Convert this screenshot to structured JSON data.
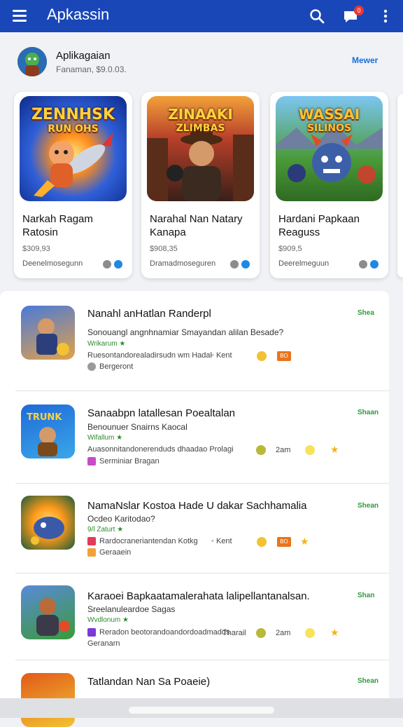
{
  "app": {
    "title": "Apkassin",
    "notification_count": "0"
  },
  "colors": {
    "primary": "#1a47b8",
    "accent_green": "#2e9b3a",
    "link_blue": "#1a6fd6"
  },
  "profile": {
    "name": "Aplikagaian",
    "subtitle": "Fanaman, $9.0.03.",
    "link": "Mewer"
  },
  "featured": [
    {
      "art_title": "ZENNHSK",
      "art_sub": "RUN OHS",
      "title": "Narkah Ragam Ratosin",
      "price": "$309,93",
      "developer": "Deenelmosegunn"
    },
    {
      "art_title": "ZINAAKI",
      "art_sub": "ZLIMBAS",
      "title": "Narahal Nan Natary Kanapa",
      "price": "$908,35",
      "developer": "Dramadmoseguren"
    },
    {
      "art_title": "WASSAI",
      "art_sub": "SILINOS",
      "title": "Hardani Papkaan Reaguss",
      "price": "$909,5",
      "developer": "Deerelmeguun"
    }
  ],
  "list": [
    {
      "title": "Nanahl anHatlan Randerpl",
      "desc": "Sonouangl angnhnamiar Smayandan alilan Besade?",
      "category": "Wrikarum ★",
      "meta": "Ruesontandorealadirsudn wm Hadal",
      "meta_extra": "Kent",
      "developer": "Bergeront",
      "status": "Shea",
      "badge_text": "BO"
    },
    {
      "title": "Sanaabpn latallesan Poealtalan",
      "desc": "Benounuer Snairns Kaocal",
      "category": "Wifallum ★",
      "meta": "Auasonnitandonerenduds dhaadao Prolagi",
      "meta_extra": "2am",
      "developer": "Serminiar Bragan",
      "status": "Shaan"
    },
    {
      "title": "NamaNslar Kostoa Hade U dakar Sachhamalia",
      "desc": "Ocdeo Karitodao?",
      "category": "9/l Zaturt ★",
      "meta": "Rardocraneriantendan Kotkg",
      "meta_extra": "Kent",
      "developer": "Geraaein",
      "status": "Shean",
      "badge_text": "BO"
    },
    {
      "title": "Karaoei Bapkaatamalerahata lalipellantanalsan.",
      "desc": "Sreelanuleardoe Sagas",
      "category": "Wvdlonum ★",
      "meta": "Reradon beotorandoandordoadmadds",
      "meta_extra": "Tharail",
      "developer": "Geranarn",
      "status": "Shan",
      "extra_time": "2am"
    },
    {
      "title": "Tatlandan Nan Sa Poaeie)",
      "status": "Shean"
    }
  ]
}
